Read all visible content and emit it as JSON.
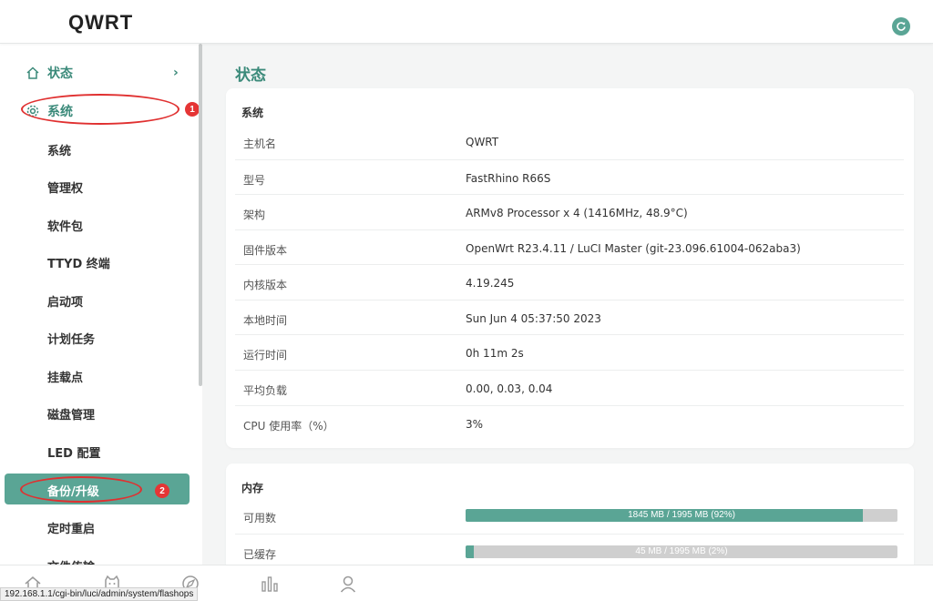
{
  "app": {
    "brand": "QWRT"
  },
  "sidebar": {
    "status": {
      "label": "状态",
      "icon": "home-icon"
    },
    "system": {
      "label": "系统",
      "icon": "gear-icon"
    },
    "items": [
      {
        "label": "系统"
      },
      {
        "label": "管理权"
      },
      {
        "label": "软件包"
      },
      {
        "label": "TTYD 终端"
      },
      {
        "label": "启动项"
      },
      {
        "label": "计划任务"
      },
      {
        "label": "挂载点"
      },
      {
        "label": "磁盘管理"
      },
      {
        "label": "LED 配置"
      },
      {
        "label": "备份/升级",
        "active": true
      },
      {
        "label": "定时重启"
      },
      {
        "label": "文件传输"
      }
    ]
  },
  "annotations": {
    "badge1": "1",
    "badge2": "2",
    "color": "#e03030"
  },
  "main": {
    "title": "状态",
    "system_card": {
      "title": "系统",
      "rows": [
        {
          "key": "主机名",
          "value": "QWRT"
        },
        {
          "key": "型号",
          "value": "FastRhino R66S"
        },
        {
          "key": "架构",
          "value": "ARMv8 Processor x 4 (1416MHz, 48.9°C)"
        },
        {
          "key": "固件版本",
          "value": "OpenWrt R23.4.11 / LuCI Master (git-23.096.61004-062aba3)"
        },
        {
          "key": "内核版本",
          "value": "4.19.245"
        },
        {
          "key": "本地时间",
          "value": "Sun Jun 4 05:37:50 2023"
        },
        {
          "key": "运行时间",
          "value": "0h 11m 2s"
        },
        {
          "key": "平均负载",
          "value": "0.00, 0.03, 0.04"
        },
        {
          "key": "CPU 使用率（%）",
          "value": "3%"
        }
      ]
    },
    "memory_card": {
      "title": "内存",
      "rows": [
        {
          "key": "可用数",
          "bar_text": "1845 MB / 1995 MB (92%)",
          "percent": 92
        },
        {
          "key": "已缓存",
          "bar_text": "45 MB / 1995 MB (2%)",
          "percent": 2
        }
      ]
    }
  },
  "tabbar": {
    "icons": [
      "home-icon",
      "mascot-icon",
      "compass-icon",
      "chart-icon",
      "user-icon"
    ]
  },
  "status_url": "192.168.1.1/cgi-bin/luci/admin/system/flashops",
  "colors": {
    "accent": "#5aa595",
    "accent_text": "#3b8a7a",
    "bar_track": "#cfcfcf"
  }
}
